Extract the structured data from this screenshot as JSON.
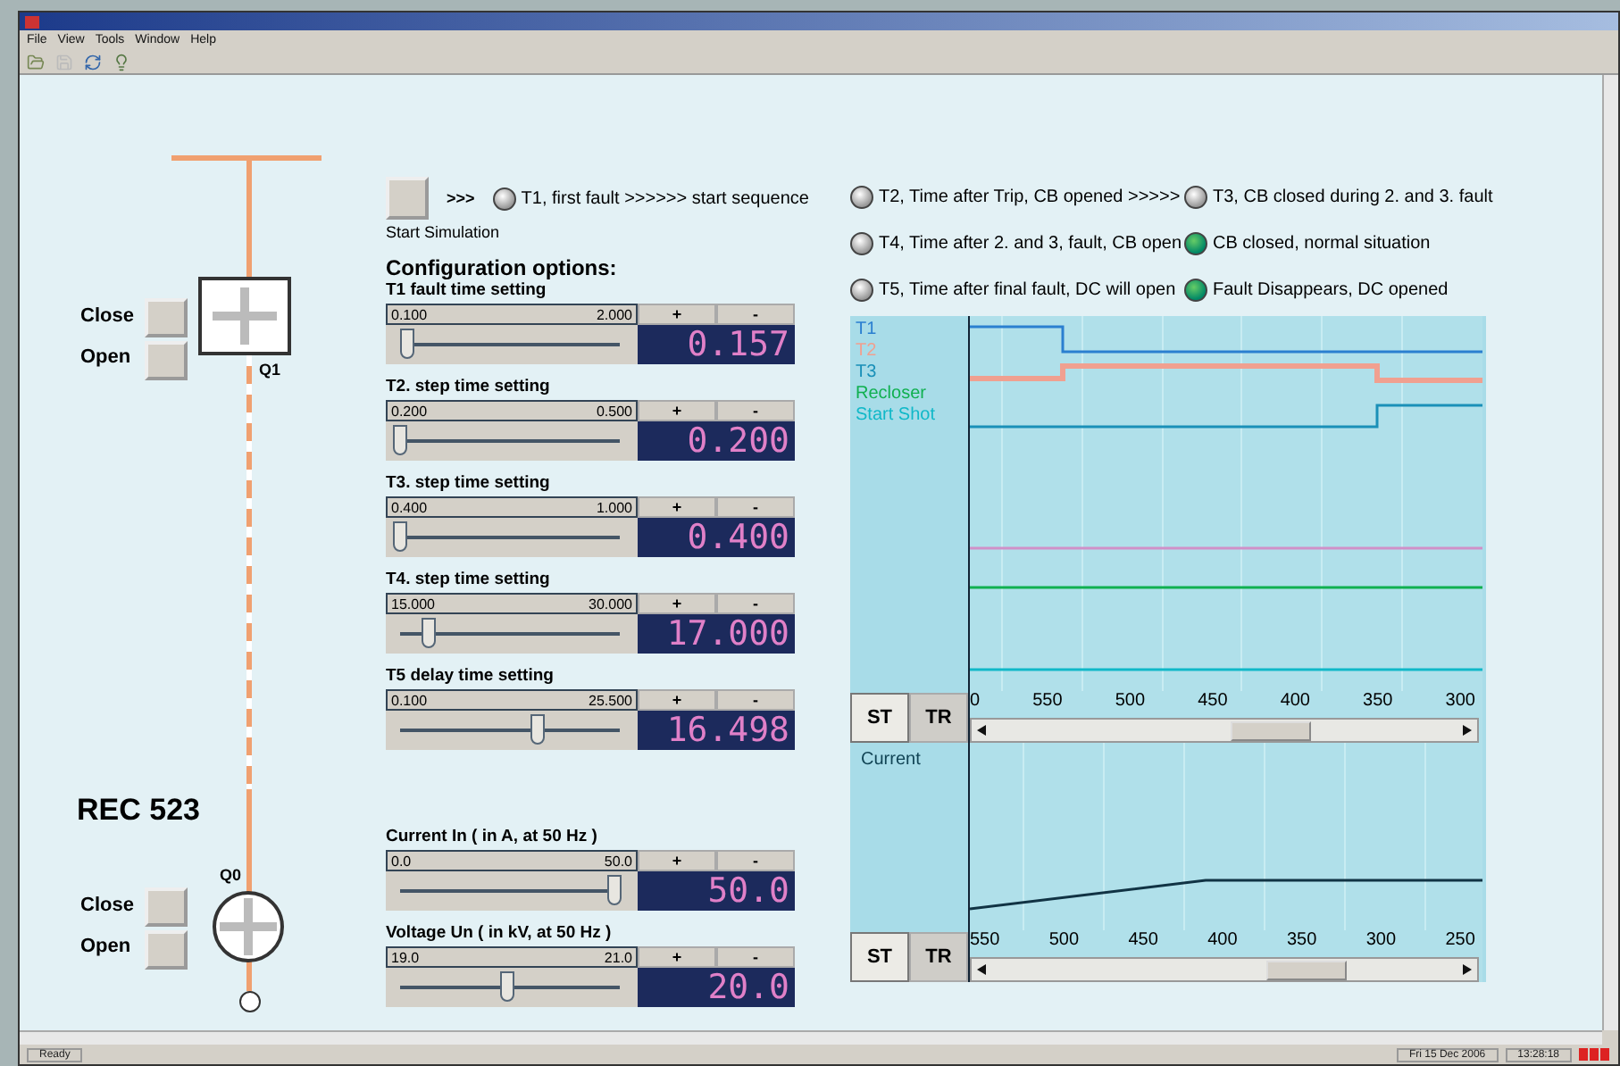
{
  "window": {
    "menu": [
      "File",
      "View",
      "Tools",
      "Window",
      "Help"
    ],
    "status_bar": {
      "text": "Ready",
      "date": "Fri 15 Dec 2006",
      "time": "13:28:18"
    }
  },
  "diagram": {
    "device": "REC 523",
    "breakers": [
      {
        "label": "Q1",
        "close": "Close",
        "open": "Open",
        "kind": "square"
      },
      {
        "label": "Q0",
        "close": "Close",
        "open": "Open",
        "kind": "round"
      }
    ]
  },
  "simulation": {
    "arrows": ">>>",
    "button_label": "Start Simulation"
  },
  "indicators": [
    {
      "label": "T1, first fault >>>>>> start sequence",
      "on": false
    },
    {
      "label": "T2, Time after Trip, CB opened >>>>>",
      "on": false
    },
    {
      "label": "T3, CB closed during 2. and 3. fault",
      "on": false
    },
    {
      "label": "T4, Time after 2. and 3, fault, CB open",
      "on": false
    },
    {
      "label": "CB closed, normal situation",
      "on": true
    },
    {
      "label": "T5, Time after final fault, DC will open",
      "on": false
    },
    {
      "label": "Fault Disappears, DC opened",
      "on": true
    }
  ],
  "config": {
    "title": "Configuration options:",
    "settings": [
      {
        "label": "T1 fault time setting",
        "min": "0.100",
        "max": "2.000",
        "increase": "+",
        "decrease": "-",
        "value": "0.157",
        "level": 0.03
      },
      {
        "label": "T2. step time setting",
        "min": "0.200",
        "max": "0.500",
        "increase": "+",
        "decrease": "-",
        "value": "0.200",
        "level": 0
      },
      {
        "label": "T3. step time setting",
        "min": "0.400",
        "max": "1.000",
        "increase": "+",
        "decrease": "-",
        "value": "0.400",
        "level": 0
      },
      {
        "label": "T4. step time setting",
        "min": "15.000",
        "max": "30.000",
        "increase": "+",
        "decrease": "-",
        "value": "17.000",
        "level": 0.13
      },
      {
        "label": "T5 delay time setting",
        "min": "0.100",
        "max": "25.500",
        "increase": "+",
        "decrease": "-",
        "value": "16.498",
        "level": 0.64
      }
    ],
    "measurements": [
      {
        "label": "Current In ( in A, at 50 Hz )",
        "min": "0.0",
        "max": "50.0",
        "increase": "+",
        "decrease": "-",
        "value": "50.0",
        "level": 1
      },
      {
        "label": "Voltage Un ( in kV, at 50 Hz )",
        "min": "19.0",
        "max": "21.0",
        "increase": "+",
        "decrease": "-",
        "value": "20.0",
        "level": 0.5
      }
    ]
  },
  "trend": {
    "legend": [
      {
        "label": "T1",
        "color": "#2a7fd0"
      },
      {
        "label": "T2",
        "color": "#f0a090"
      },
      {
        "label": "T3",
        "color": "#1a90b8"
      },
      {
        "label": "Recloser",
        "color": "#10b050"
      },
      {
        "label": "Start Shot",
        "color": "#10b8c8"
      }
    ],
    "axis": [
      "0",
      "550",
      "500",
      "450",
      "400",
      "350",
      "300"
    ],
    "tabs": [
      {
        "label": "ST",
        "selected": true
      },
      {
        "label": "TR",
        "selected": false
      }
    ]
  },
  "current": {
    "title": "Current",
    "axis": [
      "550",
      "500",
      "450",
      "400",
      "350",
      "300",
      "250"
    ],
    "tabs": [
      {
        "label": "ST",
        "selected": true
      },
      {
        "label": "TR",
        "selected": false
      }
    ]
  }
}
